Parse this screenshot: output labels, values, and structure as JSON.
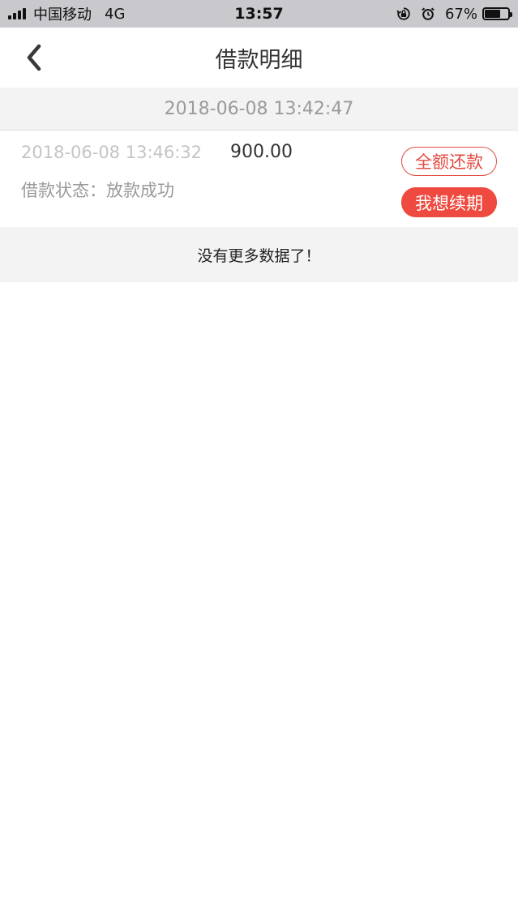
{
  "status_bar": {
    "carrier": "中国移动",
    "network": "4G",
    "time": "13:57",
    "battery_percent": "67%",
    "battery_level": 0.67
  },
  "nav": {
    "title": "借款明细"
  },
  "date_header": "2018-06-08 13:42:47",
  "record": {
    "time": "2018-06-08 13:46:32",
    "amount": "900.00",
    "status_label": "借款状态：",
    "status_value": "放款成功",
    "repay_button": "全额还款",
    "renew_button": "我想续期"
  },
  "footer": {
    "no_more": "没有更多数据了！"
  },
  "colors": {
    "accent_red": "#ee4a3f",
    "status_bar_bg": "#c9c9cd",
    "section_bg": "#f3f3f3"
  }
}
